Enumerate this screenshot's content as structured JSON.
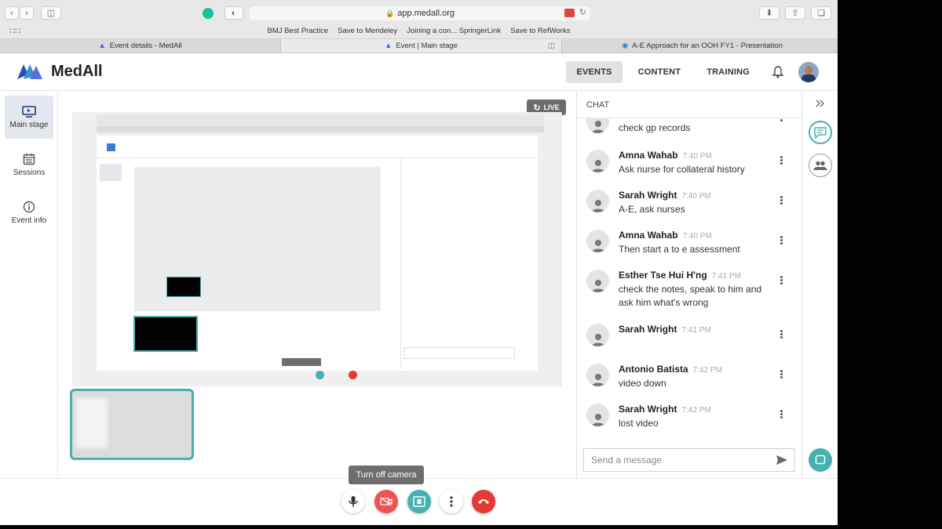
{
  "browser": {
    "url": "app.medall.org",
    "favorites": [
      "BMJ Best Practice",
      "Save to Mendeley",
      "Joining a con... SpringerLink",
      "Save to RefWorks"
    ],
    "tabs": [
      {
        "label": "Event details - MedAll",
        "active": false
      },
      {
        "label": "Event | Main stage",
        "active": true
      },
      {
        "label": "A-E Approach for an OOH FY1 - Presentation",
        "active": false
      }
    ]
  },
  "header": {
    "brand": "MedAll",
    "nav": [
      {
        "label": "EVENTS",
        "active": true
      },
      {
        "label": "CONTENT",
        "active": false
      },
      {
        "label": "TRAINING",
        "active": false
      }
    ]
  },
  "sidebar": {
    "items": [
      {
        "label": "Main stage",
        "icon": "screen-icon",
        "active": true
      },
      {
        "label": "Sessions",
        "icon": "calendar-icon",
        "active": false
      },
      {
        "label": "Event info",
        "icon": "info-icon",
        "active": false
      }
    ]
  },
  "stage": {
    "live_label": "LIVE"
  },
  "chat": {
    "title": "CHAT",
    "messages": [
      {
        "name": "",
        "time": "",
        "text": "check gp records"
      },
      {
        "name": "Amna Wahab",
        "time": "7:40 PM",
        "text": "Ask nurse for collateral history"
      },
      {
        "name": "Sarah Wright",
        "time": "7:40 PM",
        "text": "A-E, ask nurses"
      },
      {
        "name": "Amna Wahab",
        "time": "7:40 PM",
        "text": "Then start a to e assessment"
      },
      {
        "name": "Esther Tse Hui H'ng",
        "time": "7:41 PM",
        "text": "check the notes, speak to him and ask him what's wrong"
      },
      {
        "name": "Sarah Wright",
        "time": "7:41 PM",
        "text": ""
      },
      {
        "name": "Antonio Batista",
        "time": "7:42 PM",
        "text": "video down"
      },
      {
        "name": "Sarah Wright",
        "time": "7:42 PM",
        "text": "lost video"
      }
    ],
    "input_placeholder": "Send a message"
  },
  "controls": {
    "tooltip": "Turn off camera"
  },
  "colors": {
    "accent_teal": "#48b0b0",
    "end_call_red": "#e53935",
    "camera_off_red": "#ef5350"
  }
}
